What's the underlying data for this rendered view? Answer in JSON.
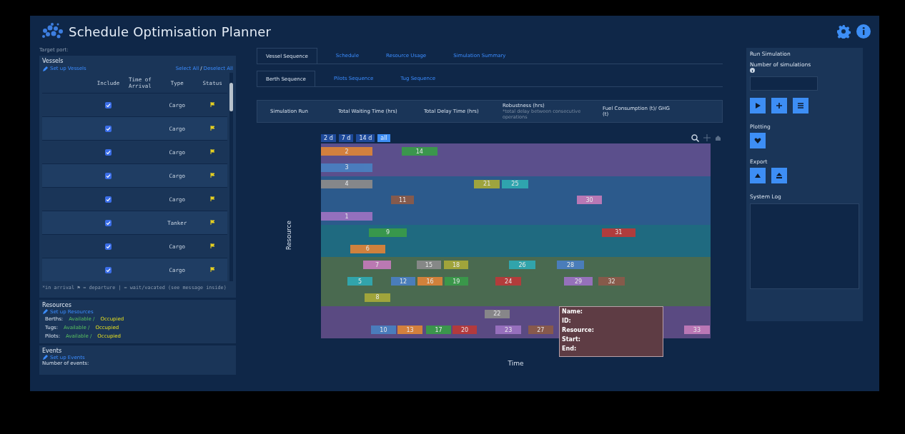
{
  "header": {
    "title": "Schedule Optimisation Planner"
  },
  "left": {
    "target_port_label": "Target port:",
    "vessels": {
      "title": "Vessels",
      "setup_link": "Set up Vessels",
      "select_all": "Select All",
      "separator": "/",
      "deselect_all": "Deselect All",
      "columns": [
        "Include",
        "Time of Arrival",
        "Type",
        "Status"
      ],
      "rows": [
        {
          "include": true,
          "type": "Cargo"
        },
        {
          "include": true,
          "type": "Cargo"
        },
        {
          "include": true,
          "type": "Cargo"
        },
        {
          "include": true,
          "type": "Cargo"
        },
        {
          "include": true,
          "type": "Cargo"
        },
        {
          "include": true,
          "type": "Tanker"
        },
        {
          "include": true,
          "type": "Cargo"
        },
        {
          "include": true,
          "type": "Cargo"
        }
      ],
      "legend": "*in arrival  ⚑ = departure  | = wait/vacated (see message inside)"
    },
    "resources": {
      "title": "Resources",
      "setup_link": "Set up Resources",
      "rows": [
        {
          "label": "Berths:",
          "available": "Available /",
          "occupied": "Occupied"
        },
        {
          "label": "Tugs:",
          "available": "Available /",
          "occupied": "Occupied"
        },
        {
          "label": "Pilots:",
          "available": "Available /",
          "occupied": "Occupied"
        }
      ]
    },
    "events": {
      "title": "Events",
      "setup_link": "Set up Events",
      "count_label": "Number of events:"
    }
  },
  "tabs": [
    {
      "label": "Vessel Sequence",
      "selected": true
    },
    {
      "label": "Schedule",
      "selected": false
    },
    {
      "label": "Resource Usage",
      "selected": false
    },
    {
      "label": "Simulation Summary",
      "selected": false
    }
  ],
  "subtabs": [
    {
      "label": "Berth Sequence",
      "selected": true
    },
    {
      "label": "Pilots Sequence",
      "selected": false
    },
    {
      "label": "Tug Sequence",
      "selected": false
    }
  ],
  "metrics_columns": [
    {
      "label": "Simulation Run"
    },
    {
      "label": "Total Waiting Time (hrs)"
    },
    {
      "label": "Total Delay Time (hrs)"
    },
    {
      "label": "Robustness (hrs)",
      "note": "*total delay between consecutive operations"
    },
    {
      "label": "Fuel Consumption (t)/ GHG (t)"
    }
  ],
  "range_buttons": [
    {
      "label": "2 d",
      "selected": false
    },
    {
      "label": "7 d",
      "selected": false
    },
    {
      "label": "14 d",
      "selected": false
    },
    {
      "label": "all",
      "selected": true
    }
  ],
  "chart": {
    "y_label": "Resource",
    "x_label": "Time",
    "lanes": [
      {
        "color": "#5b4f8c",
        "bars": [
          {
            "label": "2",
            "color": "#d9833a"
          },
          {
            "label": "14",
            "color": "#3a9a4a"
          }
        ]
      },
      {
        "color": "#5b4f8c",
        "bars": [
          {
            "label": "3",
            "color": "#4a7fc0"
          }
        ]
      },
      {
        "color": "#2c5a8c",
        "bars": [
          {
            "label": "4",
            "color": "#8a8a8a"
          },
          {
            "label": "21",
            "color": "#a5a83a"
          },
          {
            "label": "25",
            "color": "#30a8b0"
          }
        ]
      },
      {
        "color": "#2c5a8c",
        "bars": [
          {
            "label": "11",
            "color": "#8a5a4a"
          },
          {
            "label": "30",
            "color": "#c07ab8"
          }
        ]
      },
      {
        "color": "#2c5a8c",
        "bars": [
          {
            "label": "1",
            "color": "#9a72c0"
          }
        ]
      },
      {
        "color": "#1f6a80",
        "bars": [
          {
            "label": "9",
            "color": "#3a9a4a"
          },
          {
            "label": "31",
            "color": "#b83a3a"
          }
        ]
      },
      {
        "color": "#1f6a80",
        "bars": [
          {
            "label": "6",
            "color": "#d9833a"
          }
        ]
      },
      {
        "color": "#4a6a50",
        "bars": [
          {
            "label": "7",
            "color": "#c07ab8"
          },
          {
            "label": "15",
            "color": "#8a8a8a"
          },
          {
            "label": "18",
            "color": "#a5a83a"
          },
          {
            "label": "26",
            "color": "#30a8b0"
          },
          {
            "label": "28",
            "color": "#4a7fc0"
          }
        ]
      },
      {
        "color": "#4a6a50",
        "bars": [
          {
            "label": "5",
            "color": "#30a8b0"
          },
          {
            "label": "12",
            "color": "#4a7fc0"
          },
          {
            "label": "16",
            "color": "#d9833a"
          },
          {
            "label": "19",
            "color": "#3a9a4a"
          },
          {
            "label": "24",
            "color": "#b83a3a"
          },
          {
            "label": "29",
            "color": "#9a72c0"
          },
          {
            "label": "32",
            "color": "#8a5a4a"
          }
        ]
      },
      {
        "color": "#4a6a50",
        "bars": [
          {
            "label": "8",
            "color": "#a5a83a"
          }
        ]
      },
      {
        "color": "#5a4a82",
        "bars": [
          {
            "label": "22",
            "color": "#8a8a8a"
          }
        ]
      },
      {
        "color": "#5a4a82",
        "bars": [
          {
            "label": "10",
            "color": "#4a7fc0"
          },
          {
            "label": "13",
            "color": "#d9833a"
          },
          {
            "label": "17",
            "color": "#3a9a4a"
          },
          {
            "label": "20",
            "color": "#b83a3a"
          },
          {
            "label": "23",
            "color": "#9a72c0"
          },
          {
            "label": "27",
            "color": "#8a5a4a"
          },
          {
            "label": "33",
            "color": "#c07ab8"
          }
        ]
      }
    ],
    "tooltip": [
      "Name:",
      "ID:",
      "Resource:",
      "Start:",
      "End:"
    ]
  },
  "right": {
    "run_title": "Run Simulation",
    "sim_count_label": "Number of simulations",
    "plotting_title": "Plotting",
    "export_title": "Export",
    "log_title": "System Log"
  }
}
